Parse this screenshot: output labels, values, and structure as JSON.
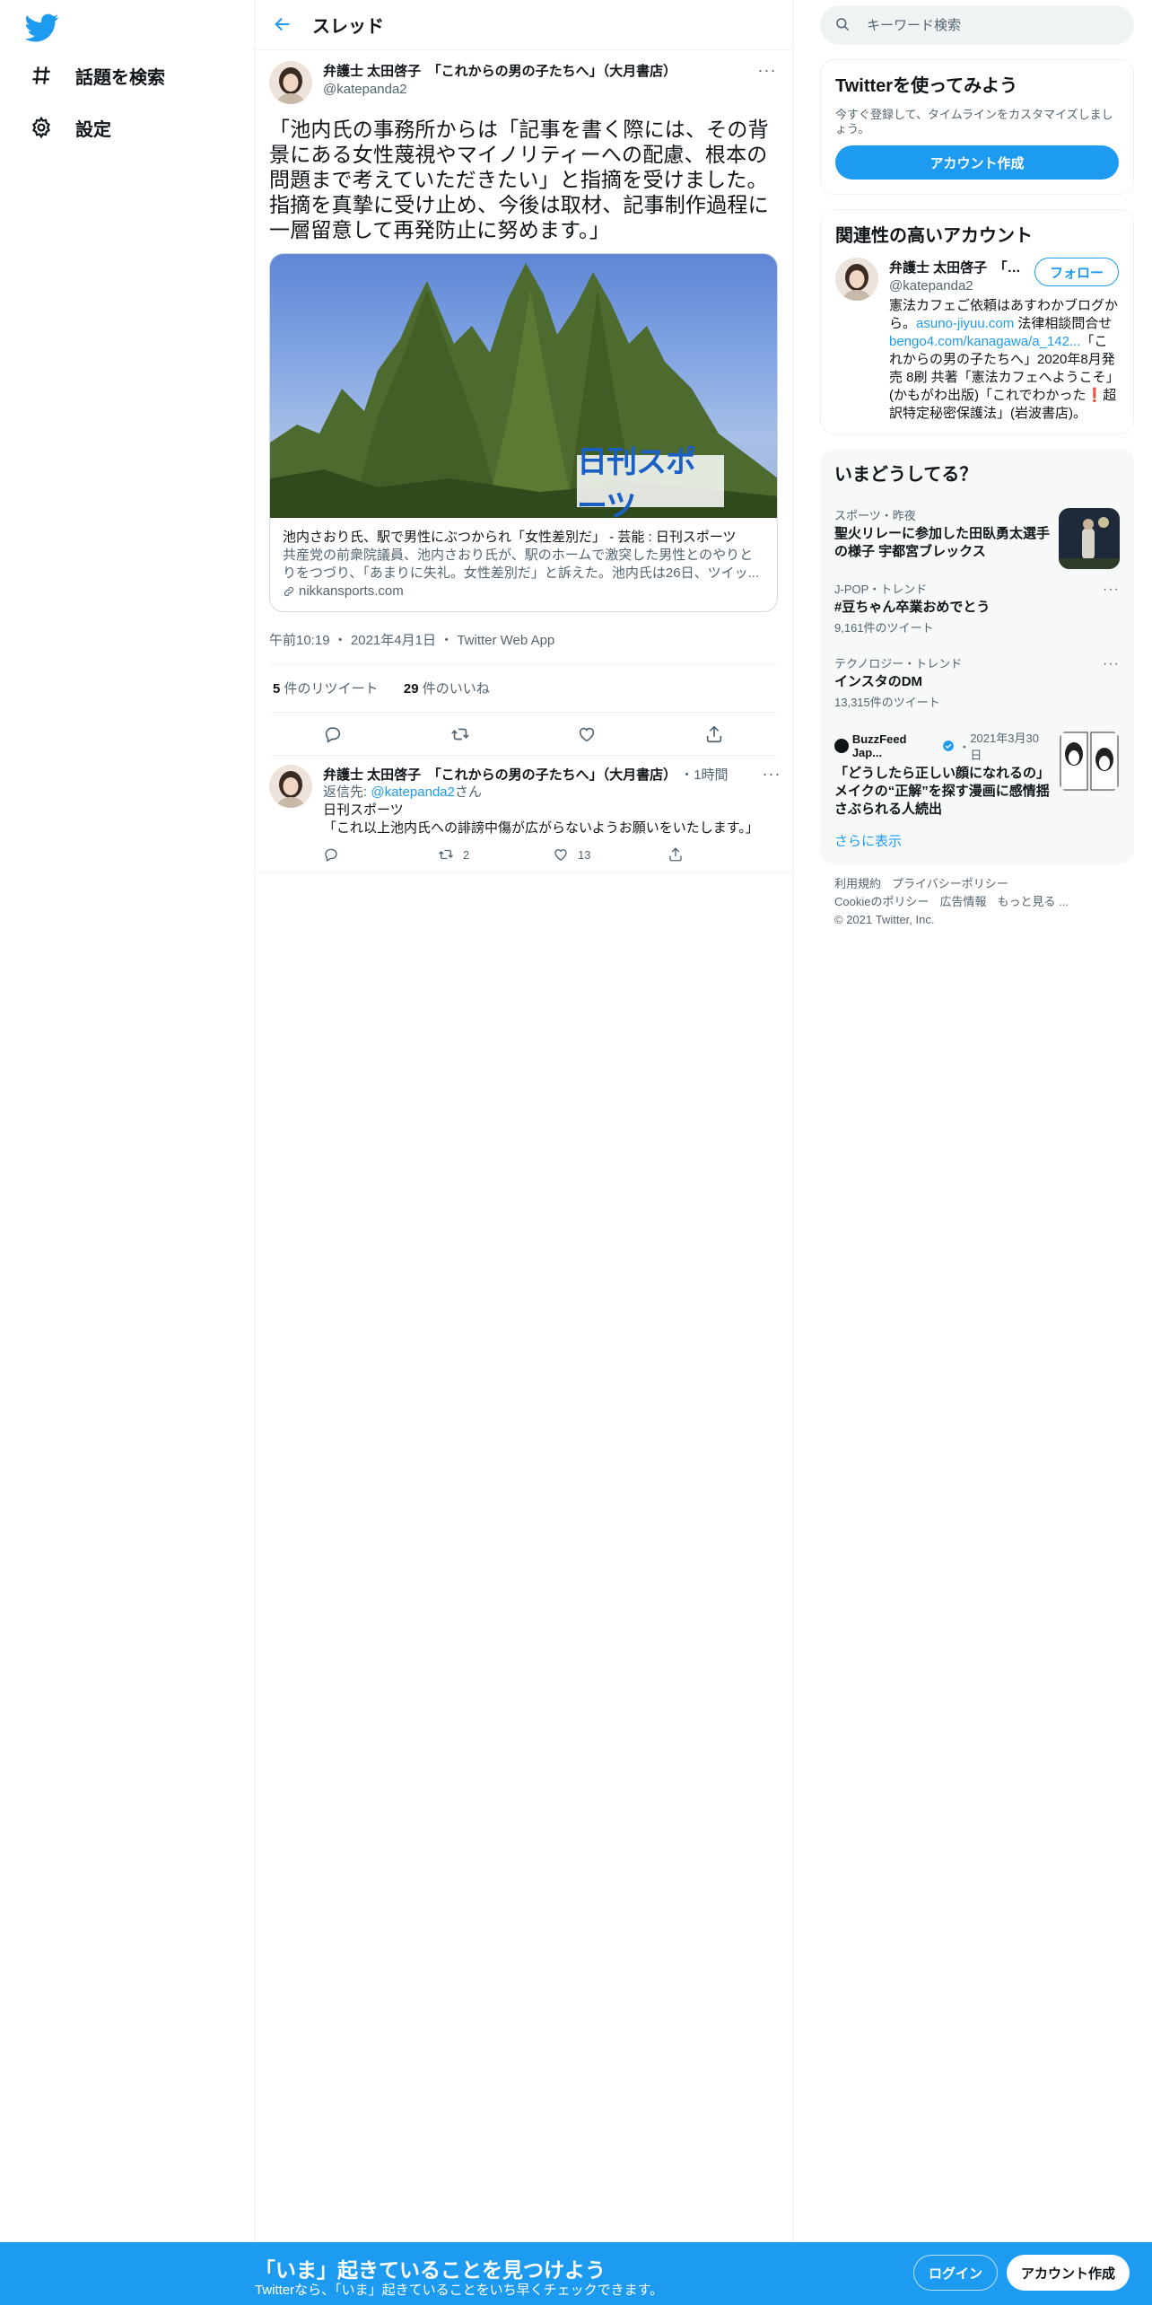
{
  "nav": {
    "explore_label": "話題を検索",
    "settings_label": "設定"
  },
  "header": {
    "title": "スレッド"
  },
  "tweet": {
    "name": "弁護士 太田啓子　「これからの男の子たちへ」（大月書店）",
    "handle": "@katepanda2",
    "text": "「池内氏の事務所からは「記事を書く際には、その背景にある女性蔑視やマイノリティーへの配慮、根本の問題まで考えていただきたい」と指摘を受けました。指摘を真摯に受け止め、今後は取材、記事制作過程に一層留意して再発防止に努めます。」",
    "card": {
      "image_text": "日刊スポーツ",
      "title": "池内さおり氏、駅で男性にぶつかられ「女性差別だ」 - 芸能 : 日刊スポーツ",
      "description": "共産党の前衆院議員、池内さおり氏が、駅のホームで激突した男性とのやりとりをつづり、「あまりに失礼。女性差別だ」と訴えた。池内氏は26日、ツイッ...",
      "domain": "nikkansports.com"
    },
    "time": "午前10:19",
    "date": "2021年4月1日",
    "source": "Twitter Web App",
    "retweets_count": "5",
    "retweets_label": "件のリツイート",
    "likes_count": "29",
    "likes_label": "件のいいね"
  },
  "reply": {
    "name": "弁護士 太田啓子　「これからの男の子たちへ」（大月書店）",
    "time": "1時間",
    "reply_prefix": "返信先:",
    "reply_to": "@katepanda2",
    "reply_suffix": "さん",
    "line1": "日刊スポーツ",
    "line2": "「これ以上池内氏への誹謗中傷が広がらないようお願いをいたします。」",
    "retweets": "2",
    "likes": "13"
  },
  "search": {
    "placeholder": "キーワード検索"
  },
  "signup_box": {
    "title": "Twitterを使ってみよう",
    "desc": "今すぐ登録して、タイムラインをカスタマイズしましょう。",
    "button": "アカウント作成"
  },
  "related": {
    "title": "関連性の高いアカウント",
    "name": "弁護士 太田啓子　「これからの男の子たちへ」（大月書店）",
    "handle": "@katepanda2",
    "follow": "フォロー",
    "bio_1": "憲法カフェご依頼はあすわかブログから。",
    "bio_link1": "asuno-jiyuu.com",
    "bio_2": " 法律相談問合せ",
    "bio_link2": "bengo4.com/kanagawa/a_142...",
    "bio_3": "「これからの男の子たちへ」2020年8月発売 8刷 共著「憲法カフェへようこそ」(かもがわ出版)「これでわかった",
    "bio_emoji": "❗",
    "bio_4": "超訳特定秘密保護法」(岩波書店)。"
  },
  "trends": {
    "title": "いまどうしてる？",
    "items": [
      {
        "context": "スポーツ・昨夜",
        "title": "聖火リレーに参加した田臥勇太選手の様子 宇都宮ブレックス"
      },
      {
        "context": "J-POP・トレンド",
        "title": "#豆ちゃん卒業おめでとう",
        "count": "9,161件のツイート"
      },
      {
        "context": "テクノロジー・トレンド",
        "title": "インスタのDM",
        "count": "13,315件のツイート"
      },
      {
        "source": "BuzzFeed Jap...",
        "date": "2021年3月30日",
        "title": "「どうしたら正しい顔になれるの」メイクの“正解”を探す漫画に感情揺さぶられる人続出"
      }
    ],
    "show_more": "さらに表示"
  },
  "footer": {
    "links": [
      "利用規約",
      "プライバシーポリシー",
      "Cookieのポリシー",
      "広告情報",
      "もっと見る ..."
    ],
    "copyright": "© 2021 Twitter, Inc."
  },
  "bottombar": {
    "title": "「いま」起きていることを見つけよう",
    "subtitle": "Twitterなら、「いま」起きていることをいち早くチェックできます。",
    "login": "ログイン",
    "signup": "アカウント作成"
  },
  "colors": {
    "accent": "#1d9bf0",
    "text": "#0f1419",
    "muted": "#536471"
  }
}
